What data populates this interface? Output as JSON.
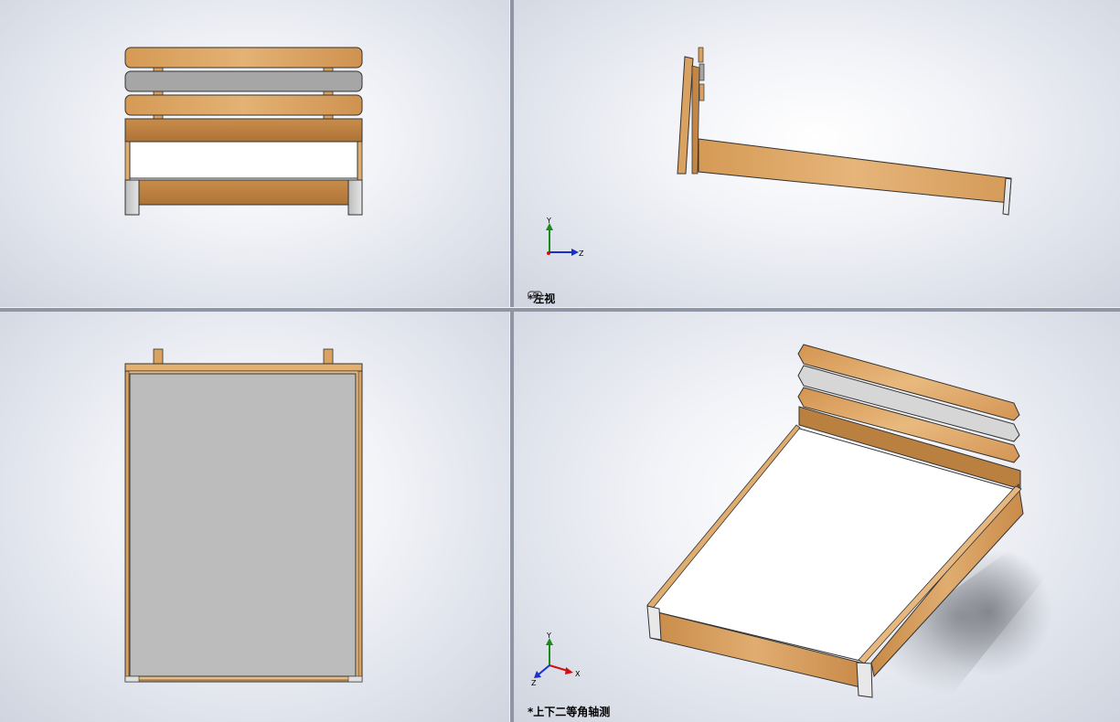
{
  "viewports": {
    "front": {
      "name": "front"
    },
    "left": {
      "label": "左视",
      "modified_marker": "*"
    },
    "top": {
      "name": "top"
    },
    "isometric": {
      "label": "上下二等角轴测",
      "modified_marker": "*"
    }
  },
  "triad": {
    "x_label": "X",
    "y_label": "Y",
    "z_label": "Z"
  },
  "colors": {
    "wood": "#d9a260",
    "wood_dark": "#b27b3f",
    "gray_slat": "#a6a6a6",
    "mattress": "#ffffff",
    "top_mattress": "#bcbcbc",
    "leg": "#d4d4d4",
    "triad_x": "#d01010",
    "triad_y": "#1a8a1a",
    "triad_z": "#1a2ec8"
  }
}
